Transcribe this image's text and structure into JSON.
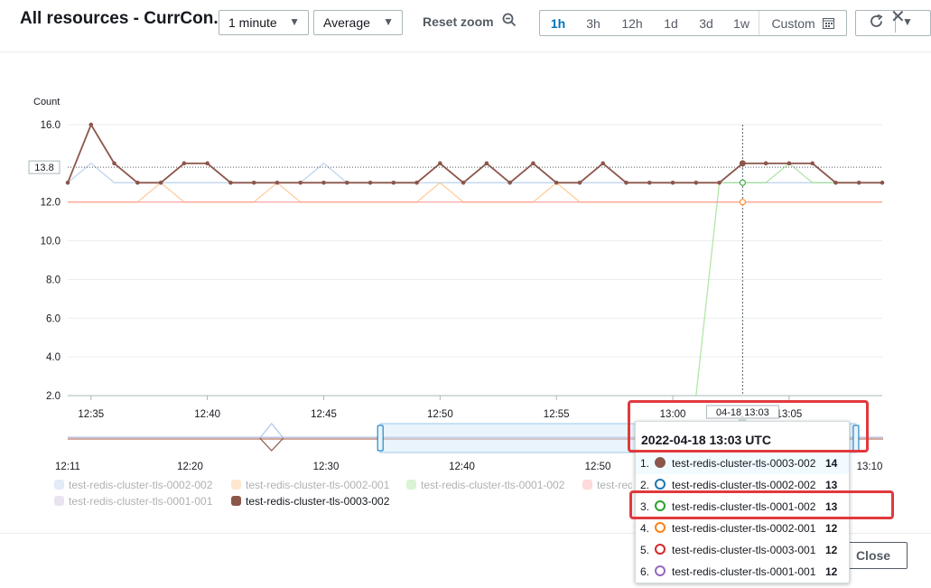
{
  "header": {
    "title": "All resources - CurrCon...",
    "period_select": "1 minute",
    "stat_select": "Average",
    "reset_zoom": "Reset zoom",
    "ranges": [
      "1h",
      "3h",
      "12h",
      "1d",
      "3d",
      "1w"
    ],
    "active_range": "1h",
    "custom_label": "Custom"
  },
  "footer": {
    "close_label": "Close"
  },
  "tooltip": {
    "title": "2022-04-18 13:03 UTC",
    "rows": [
      {
        "num": "1.",
        "name": "test-redis-cluster-tls-0003-002",
        "value": "14",
        "color": "#8c564b",
        "filled": true
      },
      {
        "num": "2.",
        "name": "test-redis-cluster-tls-0002-002",
        "value": "13",
        "color": "#1f77b4",
        "filled": false
      },
      {
        "num": "3.",
        "name": "test-redis-cluster-tls-0001-002",
        "value": "13",
        "color": "#2ca02c",
        "filled": false
      },
      {
        "num": "4.",
        "name": "test-redis-cluster-tls-0002-001",
        "value": "12",
        "color": "#ff7f0e",
        "filled": false
      },
      {
        "num": "5.",
        "name": "test-redis-cluster-tls-0003-001",
        "value": "12",
        "color": "#d62728",
        "filled": false
      },
      {
        "num": "6.",
        "name": "test-redis-cluster-tls-0001-001",
        "value": "12",
        "color": "#9467bd",
        "filled": false
      }
    ]
  },
  "crosshair": {
    "time_label": "04-18 13:03",
    "y_readout": "13.8"
  },
  "legend": [
    {
      "name": "test-redis-cluster-tls-0002-002",
      "color": "#aec7e8",
      "faded": true
    },
    {
      "name": "test-redis-cluster-tls-0002-001",
      "color": "#ffbb78",
      "faded": true
    },
    {
      "name": "test-redis-cluster-tls-0001-002",
      "color": "#98df8a",
      "faded": true
    },
    {
      "name": "test-redis-cluster-tls-0003-001",
      "color": "#ff9896",
      "faded": true
    },
    {
      "name": "test-redis-cluster-tls-0001-001",
      "color": "#c5b0d5",
      "faded": true
    },
    {
      "name": "test-redis-cluster-tls-0003-002",
      "color": "#8c564b",
      "faded": false
    }
  ],
  "chart_data": {
    "type": "line",
    "ylabel": "Count",
    "ylim": [
      2,
      16
    ],
    "yticks": [
      "2.0",
      "4.0",
      "6.0",
      "8.0",
      "10.0",
      "12.0",
      "16.0"
    ],
    "xticks": [
      "12:35",
      "12:40",
      "12:45",
      "12:50",
      "12:55",
      "13:00",
      "13:05"
    ],
    "nav_xticks": [
      "12:11",
      "12:20",
      "12:30",
      "12:40",
      "12:50",
      "13:10"
    ],
    "x": [
      "12:34",
      "12:35",
      "12:36",
      "12:37",
      "12:38",
      "12:39",
      "12:40",
      "12:41",
      "12:42",
      "12:43",
      "12:44",
      "12:45",
      "12:46",
      "12:47",
      "12:48",
      "12:49",
      "12:50",
      "12:51",
      "12:52",
      "12:53",
      "12:54",
      "12:55",
      "12:56",
      "12:57",
      "12:58",
      "12:59",
      "13:00",
      "13:01",
      "13:02",
      "13:03",
      "13:04",
      "13:05",
      "13:06",
      "13:07",
      "13:08",
      "13:09"
    ],
    "series": [
      {
        "name": "test-redis-cluster-tls-0003-002",
        "color": "#8c564b",
        "values": [
          13,
          16,
          14,
          13,
          13,
          14,
          14,
          13,
          13,
          13,
          13,
          13,
          13,
          13,
          13,
          13,
          14,
          13,
          14,
          13,
          14,
          13,
          13,
          14,
          13,
          13,
          13,
          13,
          13,
          14,
          14,
          14,
          14,
          13,
          13,
          13
        ]
      },
      {
        "name": "test-redis-cluster-tls-0002-002",
        "color": "#aec7e8",
        "values": [
          13,
          14,
          13,
          13,
          13,
          13,
          13,
          13,
          13,
          13,
          13,
          14,
          13,
          13,
          13,
          13,
          13,
          13,
          13,
          13,
          13,
          13,
          13,
          13,
          13,
          13,
          13,
          13,
          13,
          13,
          13,
          13,
          13,
          13,
          13,
          13
        ]
      },
      {
        "name": "test-redis-cluster-tls-0002-001",
        "color": "#ffbb78",
        "values": [
          12,
          12,
          12,
          12,
          13,
          12,
          12,
          12,
          12,
          13,
          12,
          12,
          12,
          12,
          12,
          12,
          13,
          12,
          12,
          12,
          12,
          13,
          12,
          12,
          12,
          12,
          12,
          12,
          12,
          12,
          12,
          12,
          12,
          12,
          12,
          12
        ]
      },
      {
        "name": "test-redis-cluster-tls-0001-002",
        "color": "#98df8a",
        "values": [
          null,
          null,
          null,
          null,
          null,
          null,
          null,
          null,
          null,
          null,
          null,
          null,
          null,
          null,
          null,
          null,
          null,
          null,
          null,
          null,
          null,
          null,
          null,
          null,
          null,
          null,
          null,
          2,
          13,
          13,
          13,
          14,
          13,
          13,
          13,
          13
        ]
      },
      {
        "name": "test-redis-cluster-tls-0003-001",
        "color": "#ff9896",
        "values": [
          12,
          12,
          12,
          12,
          12,
          12,
          12,
          12,
          12,
          12,
          12,
          12,
          12,
          12,
          12,
          12,
          12,
          12,
          12,
          12,
          12,
          12,
          12,
          12,
          12,
          12,
          12,
          12,
          12,
          12,
          12,
          12,
          12,
          12,
          12,
          12
        ]
      }
    ]
  }
}
